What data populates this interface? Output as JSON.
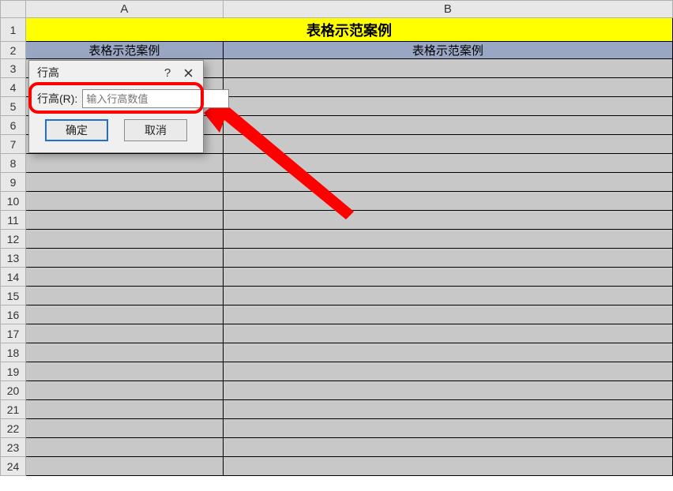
{
  "columns": {
    "A": "A",
    "B": "B"
  },
  "rows": [
    "1",
    "2",
    "3",
    "4",
    "5",
    "6",
    "7",
    "8",
    "9",
    "10",
    "11",
    "12",
    "13",
    "14",
    "15",
    "16",
    "17",
    "18",
    "19",
    "20",
    "21",
    "22",
    "23",
    "24"
  ],
  "mergedTitle": "表格示范案例",
  "subheaderA": "表格示范案例",
  "subheaderB": "表格示范案例",
  "dialog": {
    "title": "行高",
    "help": "?",
    "label": "行高(R):",
    "placeholder": "输入行高数值",
    "ok": "确定",
    "cancel": "取消"
  }
}
